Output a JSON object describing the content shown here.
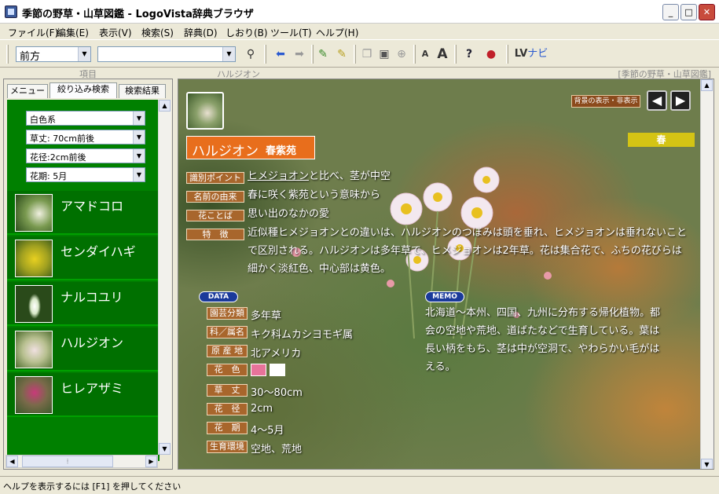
{
  "window": {
    "title": "季節の野草・山草図鑑 - LogoVista辞典ブラウザ"
  },
  "menu": [
    "ファイル(F)",
    "編集(E)",
    "表示(V)",
    "検索(S)",
    "辞典(D)",
    "しおり(B)",
    "ツール(T)",
    "ヘルプ(H)"
  ],
  "toolbar": {
    "history_value": "前方",
    "search_value": "",
    "lv_label": "ナビ"
  },
  "header": {
    "left": "項目",
    "center": "ハルジオン",
    "right": "[季節の野草・山草図鑑]"
  },
  "tabs": [
    "メニュー",
    "絞り込み検索",
    "検索結果"
  ],
  "filters": [
    "白色系",
    "草丈: 70cm前後",
    "花径:2cm前後",
    "花期: 5月"
  ],
  "plants": [
    "アマドコロ",
    "センダイハギ",
    "ナルコユリ",
    "ハルジオン",
    "ヒレアザミ"
  ],
  "entry": {
    "name": "ハルジオン",
    "kanji": "春紫苑",
    "season": "春",
    "bg_toggle": "背景の表示・非表示",
    "rows": [
      {
        "label": "識別ポイント",
        "text": "ヒメジョオンと比べ、茎が中空"
      },
      {
        "label": "名前の由来",
        "text": "春に咲く紫苑という意味から"
      },
      {
        "label": "花ことば",
        "text": "思い出のなかの愛"
      },
      {
        "label": "特　徴",
        "text": "近似種ヒメジョオンとの違いは、ハルジオンのつぼみは頭を垂れ、ヒメジョオンは垂れないことで区別される。ハルジオンは多年草で、ヒメジョオンは2年草。花は集合花で、ふちの花びらは細かく淡紅色、中心部は黄色。"
      }
    ],
    "data_badge": "DATA",
    "memo_badge": "MEMO",
    "data": [
      {
        "label": "園芸分類",
        "value": "多年草"
      },
      {
        "label": "科／属名",
        "value": "キク科ムカシヨモギ属"
      },
      {
        "label": "原 産 地",
        "value": "北アメリカ"
      },
      {
        "label": "花　色",
        "value": ""
      },
      {
        "label": "草　丈",
        "value": "30〜80cm"
      },
      {
        "label": "花　径",
        "value": "2cm"
      },
      {
        "label": "花　期",
        "value": "4〜5月"
      },
      {
        "label": "生育環境",
        "value": "空地、荒地"
      }
    ],
    "flower_colors": [
      "#e8739a",
      "#ffffff"
    ],
    "memo": "北海道〜本州、四国、九州に分布する帰化植物。都会の空地や荒地、道ばたなどで生育している。葉は長い柄をもち、茎は中が空洞で、やわらかい毛がはえる。"
  },
  "status": "ヘルプを表示するには [F1] を押してください"
}
